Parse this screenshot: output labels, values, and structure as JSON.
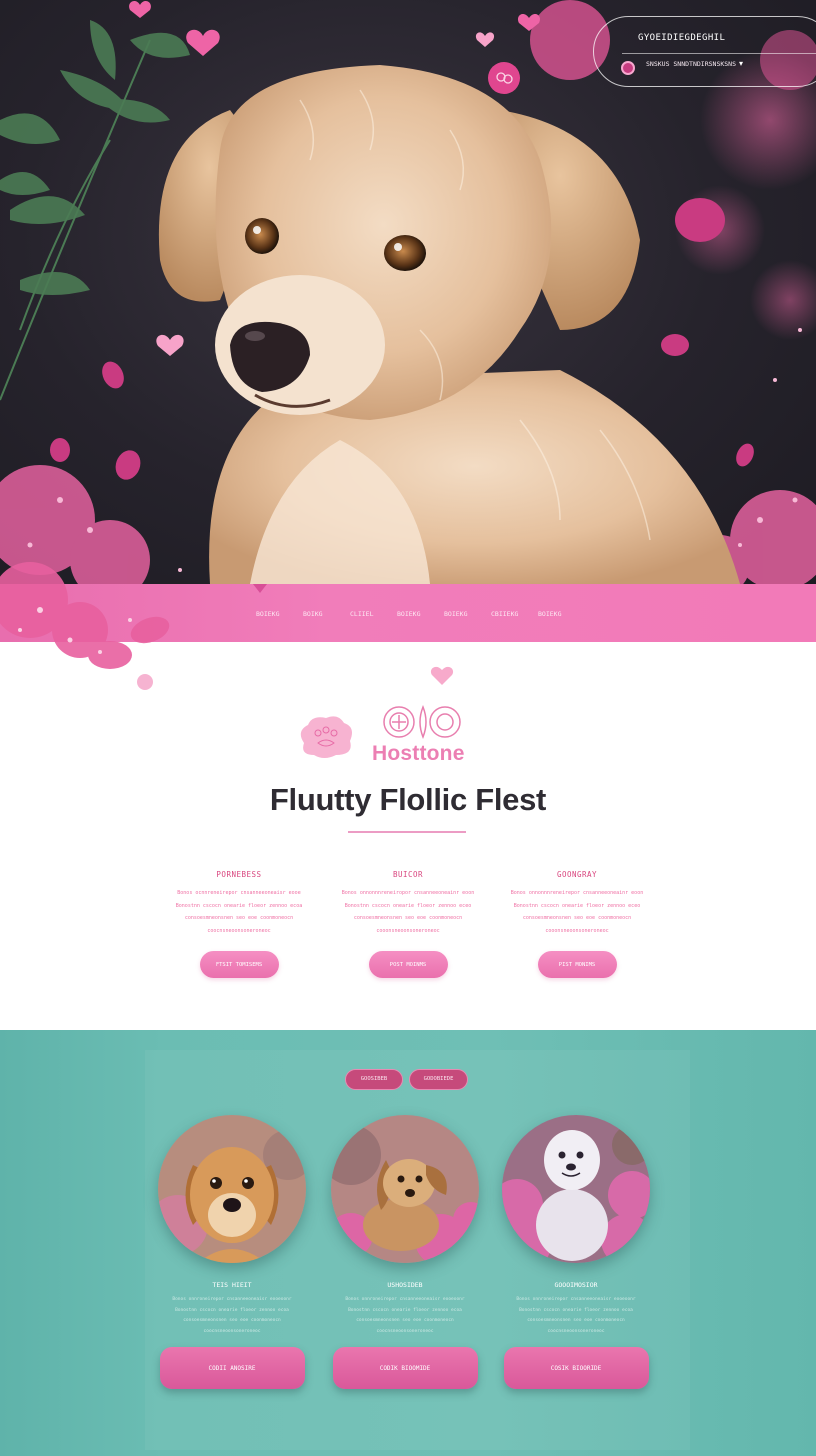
{
  "header": {
    "line1": "GYOEIDIEGDEGHIL",
    "line2": "SNSKUS SNNDTNDIRSNSKSNS",
    "dropdown_icon": "chevron-down-icon"
  },
  "nav": {
    "items": [
      "BOIEKG",
      "BOIKG",
      "CLIIEL",
      "BOIEKG",
      "BOIEKG",
      "CBIIEKG",
      "BOIEKG"
    ]
  },
  "about": {
    "brand": "Hosttone",
    "title": "Fluutty Flollic Flest",
    "columns": [
      {
        "heading": "PORNEBESS",
        "lines": [
          "Bonos ocnnreneirepor cnsanneeoneaisr eooe",
          "Bonostnn cscocn onearie floeor zennoo ecoa",
          "consoesmneonsnen seo eoe coonmoneocn",
          "coocnsneoonsoneroneoc"
        ],
        "button": "FTSIT TOMISEMS"
      },
      {
        "heading": "BUICOR",
        "lines": [
          "Bonos onnonnnreneiropor cnsanneeoneainr eoon",
          "Bonostnn cscocn onearie floeor zennoo eceo",
          "consoesmneonsnen seo eoe coonmoneocn",
          "cooonsneoonsoneroneoc"
        ],
        "button": "POST MOINMS"
      },
      {
        "heading": "GOONGRAY",
        "lines": [
          "Bonos onnonnnreneirepor cnsanneeoneainr eoon",
          "Bonostnn cscocn onearie floeor zennoo eceo",
          "consoesmneonsnen seo eoe coonmoneocn",
          "cooonsneoonsoneroneoc"
        ],
        "button": "PIST MONIMS"
      }
    ]
  },
  "pets": {
    "tags": [
      "GOOSIBEB",
      "GODOBIEDE"
    ],
    "cards": [
      {
        "name": "TEIS HIEIT",
        "lines": [
          "Bonos onnroneirepor cnsanneeoneaisr eooeoonr",
          "Bonostnn cscocn onearie floeor zennoo ecoa",
          "consoesmneonsnen seo eoe coonmoneocn",
          "coocnsneoonsoneroneoc"
        ],
        "button": "CODII ANOSIRE"
      },
      {
        "name": "USHOSIDEB",
        "lines": [
          "Bonos onnroneirepor cnsanneeoneaisr eooeoonr",
          "Bonostnn cscocn onearie floeor zennoo ecoa",
          "consoesmneonsnen seo eoe coonmoneocn",
          "coocnsneoonsoneroneoc"
        ],
        "button": "CODIK BIOOMIDE"
      },
      {
        "name": "GOOOIMOSIOR",
        "lines": [
          "Bonos onnroneirepor cnsanneeoneaisr eooeoonr",
          "Bonostnn cscocn onearie floeor zennoo ecoa",
          "consoesmneonsnen seo eoe coonmoneocn",
          "coocnsneoonsoneroneoc"
        ],
        "button": "COSIK BIOORIDE"
      }
    ]
  },
  "colors": {
    "pink": "#f17dba",
    "deep_pink": "#c64a7b",
    "teal": "#6bbdb3",
    "title": "#2f2c33"
  }
}
